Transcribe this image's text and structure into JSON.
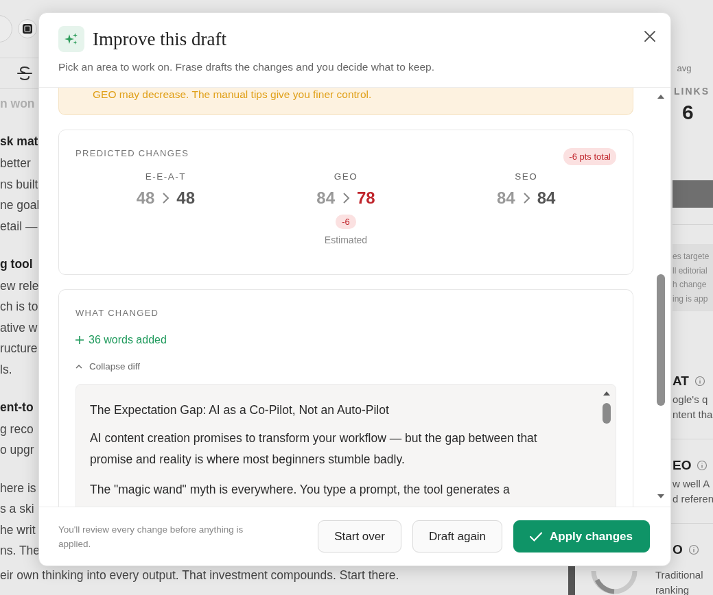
{
  "background": {
    "left_blocks": [
      {
        "kind": "faded",
        "lines": [
          "n won"
        ]
      },
      {
        "kind": "heading",
        "lines": [
          "sk mat"
        ]
      },
      {
        "kind": "body",
        "lines": [
          "better",
          "ns built",
          "ne goal",
          "etail —"
        ]
      },
      {
        "kind": "heading",
        "lines": [
          "g tool"
        ]
      },
      {
        "kind": "body",
        "lines": [
          "ew rele",
          "ch is to",
          "ative w",
          "ructure",
          "ls."
        ]
      },
      {
        "kind": "heading",
        "lines": [
          "ent-to"
        ]
      },
      {
        "kind": "body",
        "lines": [
          "g reco",
          "o upgr"
        ]
      },
      {
        "kind": "body",
        "lines": [
          "here is",
          "s a ski",
          "he writ",
          "ns. The"
        ]
      }
    ],
    "last_line": "eir own thinking into every output. That investment compounds. Start there.",
    "stats": {
      "unit": "avg",
      "label": "LINKS",
      "value": "6"
    },
    "note_lines": [
      "es targete",
      "ll editorial",
      "h change",
      "ing is app"
    ],
    "sections": [
      {
        "title": "AT",
        "lines": [
          "ogle's q",
          "ntent tha"
        ]
      },
      {
        "title": "EO",
        "lines": [
          "w well A",
          "d referen"
        ]
      },
      {
        "title": "O",
        "lines": [
          "Traditional",
          "ranking"
        ]
      }
    ]
  },
  "modal": {
    "title": "Improve this draft",
    "subtitle": "Pick an area to work on. Frase drafts the changes and you decide what to keep.",
    "warning": "GEO may decrease. The manual tips give you finer control.",
    "predicted": {
      "heading": "PREDICTED CHANGES",
      "total_badge": "-6 pts total",
      "metrics": [
        {
          "label": "E-E-A-T",
          "before": "48",
          "after": "48",
          "decreased": false
        },
        {
          "label": "GEO",
          "before": "84",
          "after": "78",
          "decreased": true,
          "delta": "-6",
          "note": "Estimated"
        },
        {
          "label": "SEO",
          "before": "84",
          "after": "84",
          "decreased": false
        }
      ]
    },
    "changes": {
      "heading": "WHAT CHANGED",
      "summary": "36 words added",
      "toggle": "Collapse diff",
      "diff": [
        "The Expectation Gap: AI as a Co-Pilot, Not an Auto-Pilot",
        "AI content creation promises to transform your workflow — but the gap between that promise and reality is where most beginners stumble badly.",
        "The \"magic wand\" myth is everywhere. You type a prompt, the tool generates a"
      ]
    },
    "footer_note": "You'll review every change before anything is applied.",
    "buttons": [
      {
        "label": "Start over",
        "kind": "secondary"
      },
      {
        "label": "Draft again",
        "kind": "secondary"
      },
      {
        "label": "Apply changes",
        "kind": "primary"
      }
    ]
  }
}
